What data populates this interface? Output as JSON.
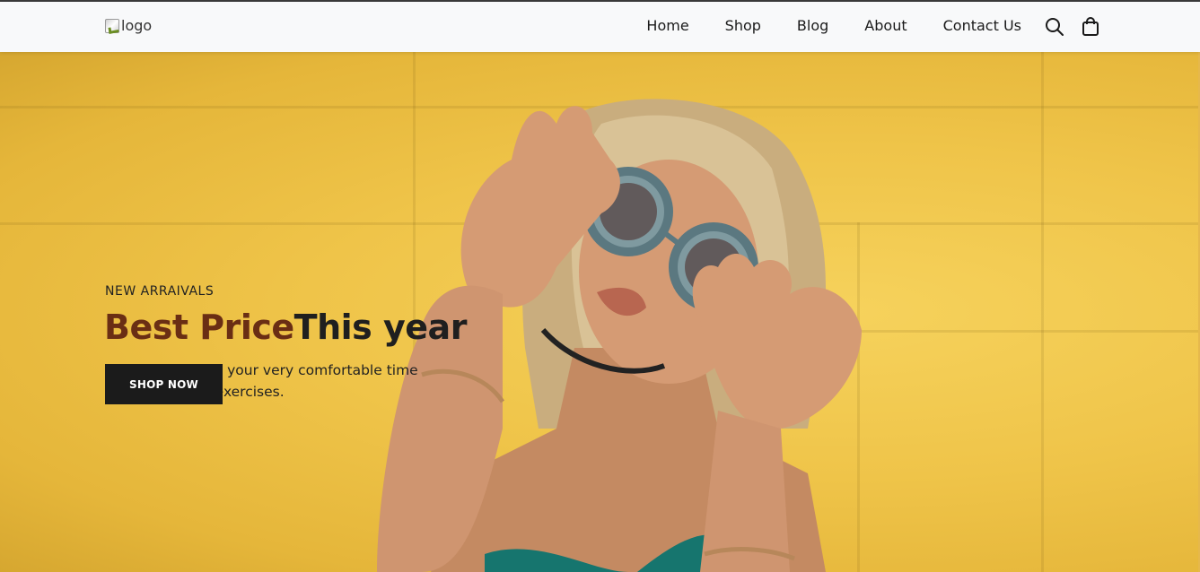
{
  "header": {
    "logo_alt": "logo",
    "nav": [
      {
        "label": "Home"
      },
      {
        "label": "Shop"
      },
      {
        "label": "Blog"
      },
      {
        "label": "About"
      },
      {
        "label": "Contact Us"
      }
    ],
    "icons": [
      "search-icon",
      "shopping-bag-icon"
    ]
  },
  "hero": {
    "kicker": "NEW ARRAIVALS",
    "headline_part1": "Best Price",
    "headline_part2": "This year",
    "description": "Shoomatic offers your very comfortable time on walking and exercises.",
    "cta_label": "SHOP NOW"
  },
  "colors": {
    "accent_brown": "#6a2e14",
    "dark": "#1b1b1b",
    "hero_yellow": "#efc449",
    "header_bg": "#f8f9fa"
  }
}
